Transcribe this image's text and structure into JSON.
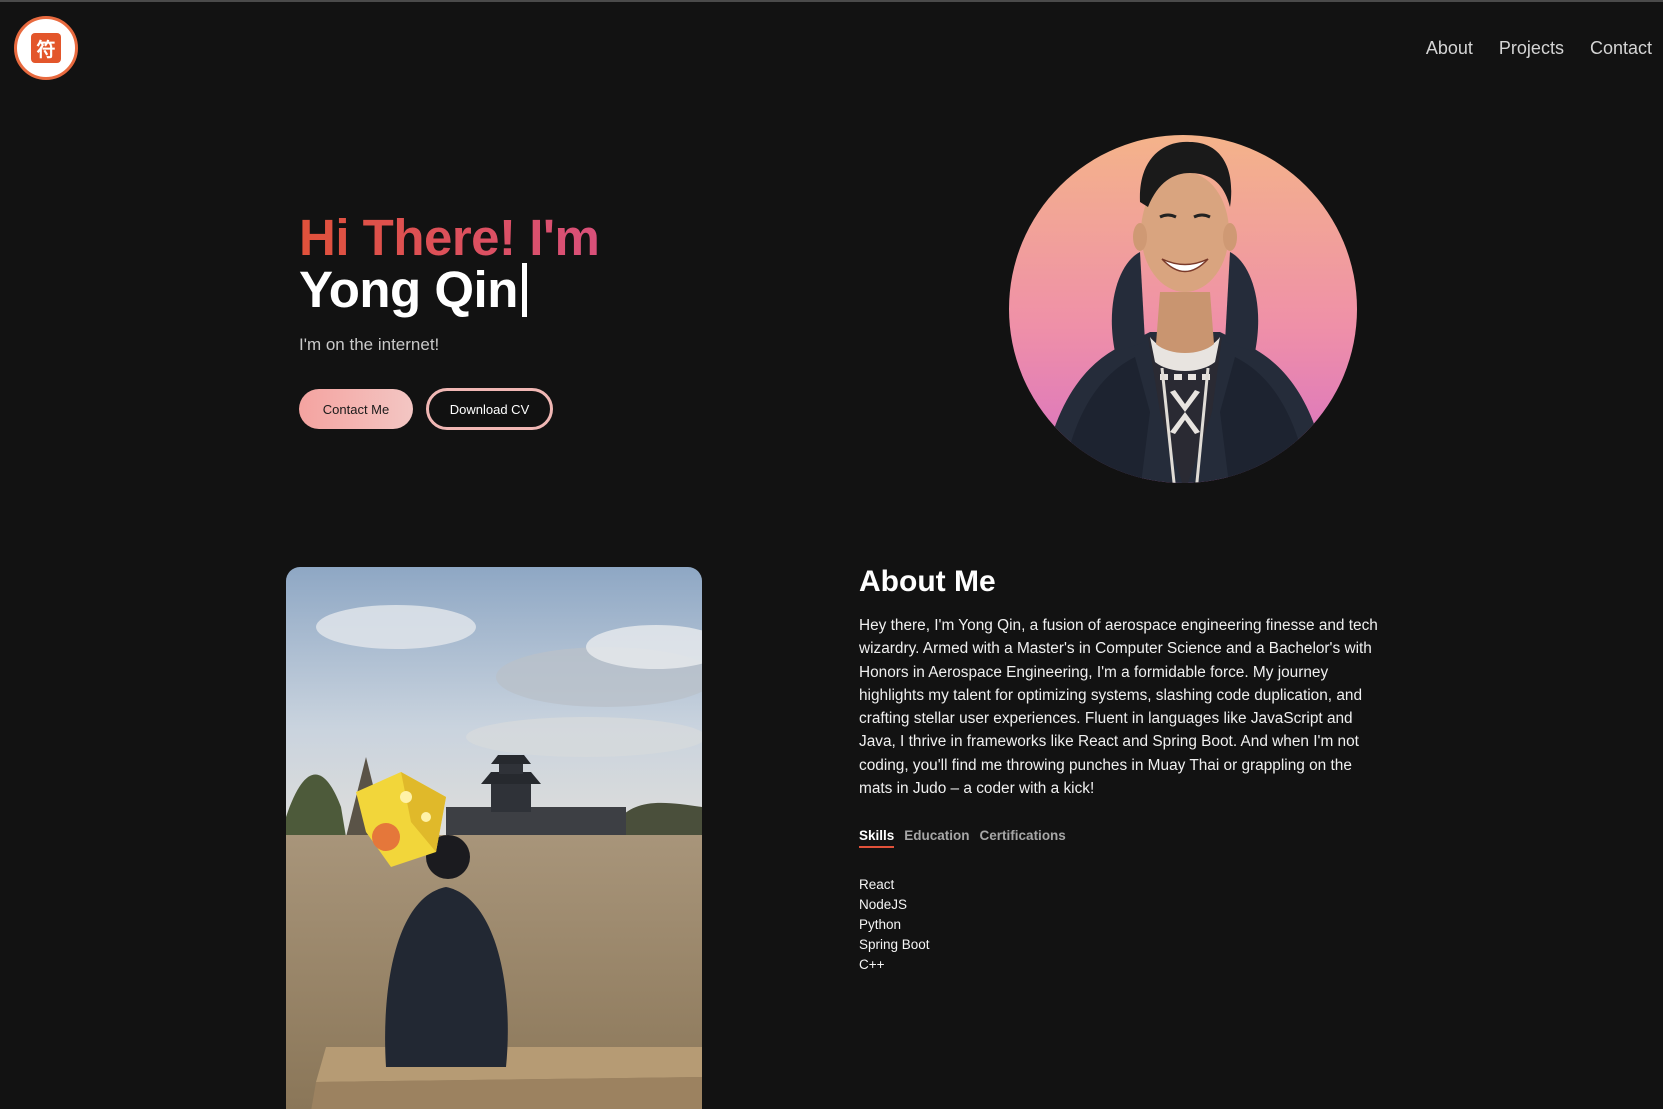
{
  "header": {
    "logo_glyph": "符",
    "nav": [
      {
        "label": "About"
      },
      {
        "label": "Projects"
      },
      {
        "label": "Contact"
      }
    ]
  },
  "hero": {
    "greeting": "Hi There! I'm",
    "name": "Yong Qin",
    "subtitle": "I'm on the internet!",
    "contact_button": "Contact Me",
    "cv_button": "Download CV"
  },
  "about": {
    "title": "About Me",
    "paragraph": "Hey there, I'm Yong Qin, a fusion of aerospace engineering finesse and tech wizardry. Armed with a Master's in Computer Science and a Bachelor's with Honors in Aerospace Engineering, I'm a formidable force. My journey highlights my talent for optimizing systems, slashing code duplication, and crafting stellar user experiences. Fluent in languages like JavaScript and Java, I thrive in frameworks like React and Spring Boot. And when I'm not coding, you'll find me throwing punches in Muay Thai or grappling on the mats in Judo – a coder with a kick!",
    "tabs": [
      {
        "label": "Skills",
        "active": true
      },
      {
        "label": "Education",
        "active": false
      },
      {
        "label": "Certifications",
        "active": false
      }
    ],
    "skills": [
      "React",
      "NodeJS",
      "Python",
      "Spring Boot",
      "C++"
    ]
  },
  "colors": {
    "background": "#121212",
    "accent_red": "#e0513a",
    "accent_pink": "#d9507a",
    "button_pink": "#f4a3a0"
  }
}
